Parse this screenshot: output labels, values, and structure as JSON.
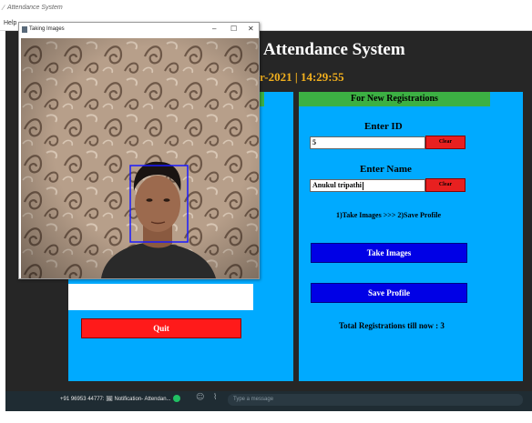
{
  "outer_window": {
    "title": "Attendance System",
    "menu_help": "Help"
  },
  "header": {
    "title": "Attendance System",
    "datetime": "ber-2021  |  14:29:55"
  },
  "left_panel": {
    "quit_label": "Quit"
  },
  "registration": {
    "header": "For New Registrations",
    "id_label": "Enter ID",
    "id_value": "5",
    "clear_label": "Clear",
    "name_label": "Enter Name",
    "name_value": "Anukul tripathi",
    "instructions": "1)Take Images  >>>  2)Save Profile",
    "take_images_label": "Take Images",
    "save_profile_label": "Save Profile",
    "total_label": "Total Registrations till now  : 3"
  },
  "camera_window": {
    "title": "Taking Images",
    "controls": {
      "minimize": "–",
      "maximize": "☐",
      "close": "✕"
    }
  },
  "taskbar": {
    "notification": "+91 96953 44777: 🖼 Notification- Attendan...",
    "message_placeholder": "Type a message"
  },
  "colors": {
    "panel_blue": "#00aaff",
    "header_green": "#3cb043",
    "quit_red": "#ff1a1a",
    "button_blue": "#0000e6",
    "title_white": "#ffffff",
    "datetime_gold": "#f2b01e",
    "face_box": "#1a1aff"
  }
}
